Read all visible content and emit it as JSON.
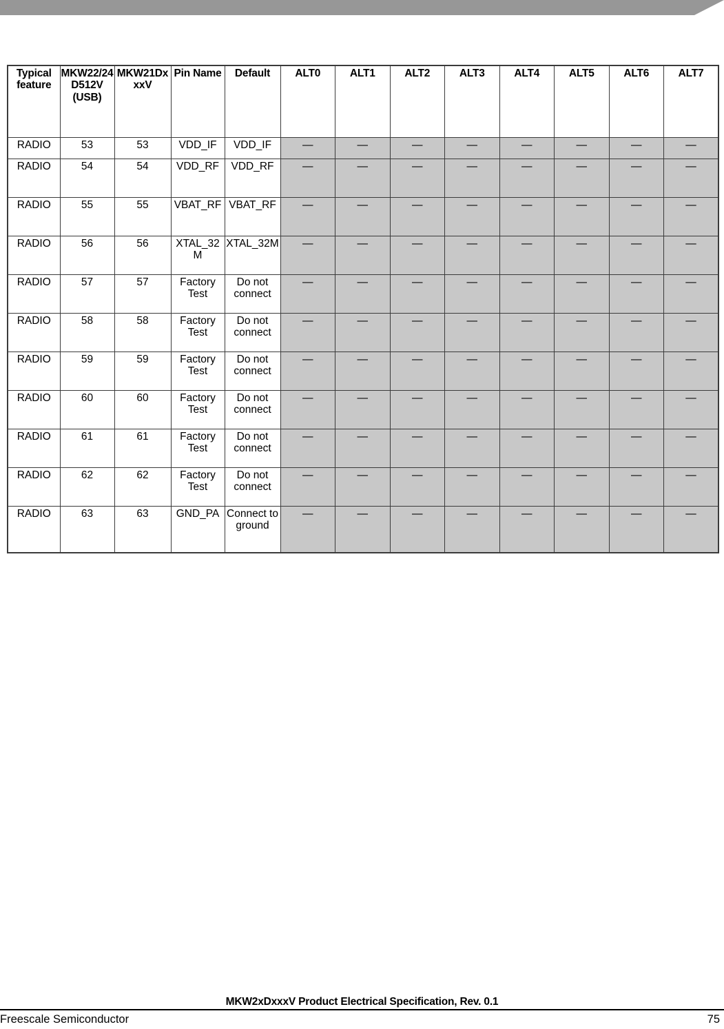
{
  "page": {
    "banner_color": "#979797",
    "alt_cell_color": "#c8c8c8",
    "border_color": "#3a3a3a"
  },
  "table": {
    "headers": [
      "Typical feature",
      "MKW22/24D512V (USB)",
      "MKW21DxxxV",
      "Pin Name",
      "Default",
      "ALT0",
      "ALT1",
      "ALT2",
      "ALT3",
      "ALT4",
      "ALT5",
      "ALT6",
      "ALT7"
    ],
    "dash": "—",
    "rows": [
      {
        "feature": "RADIO",
        "mkw22": "53",
        "mkw21": "53",
        "pin_name": "VDD_IF",
        "default": "VDD_IF",
        "alt": [
          "—",
          "—",
          "—",
          "—",
          "—",
          "—",
          "—",
          "—"
        ]
      },
      {
        "feature": "RADIO",
        "mkw22": "54",
        "mkw21": "54",
        "pin_name": "VDD_RF",
        "default": "VDD_RF",
        "alt": [
          "—",
          "—",
          "—",
          "—",
          "—",
          "—",
          "—",
          "—"
        ]
      },
      {
        "feature": "RADIO",
        "mkw22": "55",
        "mkw21": "55",
        "pin_name": "VBAT_RF",
        "default": "VBAT_RF",
        "alt": [
          "—",
          "—",
          "—",
          "—",
          "—",
          "—",
          "—",
          "—"
        ]
      },
      {
        "feature": "RADIO",
        "mkw22": "56",
        "mkw21": "56",
        "pin_name": "XTAL_32M",
        "default": "XTAL_32M",
        "alt": [
          "—",
          "—",
          "—",
          "—",
          "—",
          "—",
          "—",
          "—"
        ]
      },
      {
        "feature": "RADIO",
        "mkw22": "57",
        "mkw21": "57",
        "pin_name": "Factory Test",
        "default": "Do not connect",
        "alt": [
          "—",
          "—",
          "—",
          "—",
          "—",
          "—",
          "—",
          "—"
        ]
      },
      {
        "feature": "RADIO",
        "mkw22": "58",
        "mkw21": "58",
        "pin_name": "Factory Test",
        "default": "Do not connect",
        "alt": [
          "—",
          "—",
          "—",
          "—",
          "—",
          "—",
          "—",
          "—"
        ]
      },
      {
        "feature": "RADIO",
        "mkw22": "59",
        "mkw21": "59",
        "pin_name": "Factory Test",
        "default": "Do not connect",
        "alt": [
          "—",
          "—",
          "—",
          "—",
          "—",
          "—",
          "—",
          "—"
        ]
      },
      {
        "feature": "RADIO",
        "mkw22": "60",
        "mkw21": "60",
        "pin_name": "Factory Test",
        "default": "Do not connect",
        "alt": [
          "—",
          "—",
          "—",
          "—",
          "—",
          "—",
          "—",
          "—"
        ]
      },
      {
        "feature": "RADIO",
        "mkw22": "61",
        "mkw21": "61",
        "pin_name": "Factory Test",
        "default": "Do not connect",
        "alt": [
          "—",
          "—",
          "—",
          "—",
          "—",
          "—",
          "—",
          "—"
        ]
      },
      {
        "feature": "RADIO",
        "mkw22": "62",
        "mkw21": "62",
        "pin_name": "Factory Test",
        "default": "Do not connect",
        "alt": [
          "—",
          "—",
          "—",
          "—",
          "—",
          "—",
          "—",
          "—"
        ]
      },
      {
        "feature": "RADIO",
        "mkw22": "63",
        "mkw21": "63",
        "pin_name": "GND_PA",
        "default": "Connect to ground",
        "alt": [
          "—",
          "—",
          "—",
          "—",
          "—",
          "—",
          "—",
          "—"
        ]
      }
    ]
  },
  "footer": {
    "title": "MKW2xDxxxV Product Electrical Specification, Rev. 0.1",
    "left": "Freescale Semiconductor",
    "page_number": "75"
  }
}
